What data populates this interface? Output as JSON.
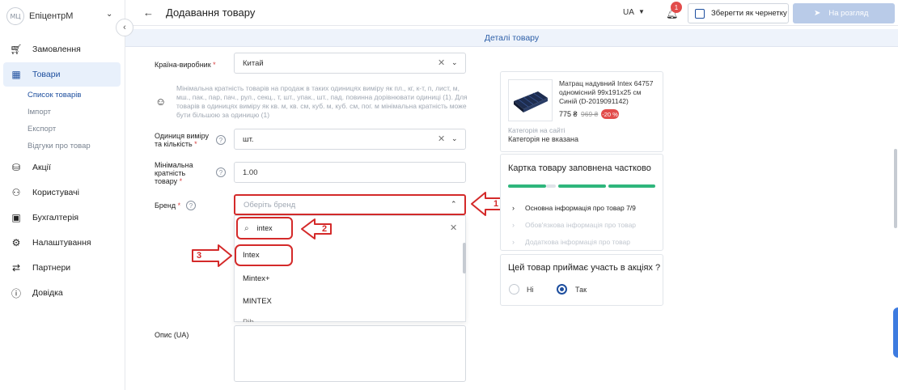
{
  "sidebar": {
    "logo_text": "МЦ",
    "brand_name": "ЕпіцентрМ",
    "items": [
      {
        "label": "Замовлення",
        "icon": "cart-icon"
      },
      {
        "label": "Товари",
        "icon": "box-icon"
      },
      {
        "label": "Акції",
        "icon": "promo-bag-icon"
      },
      {
        "label": "Користувачі",
        "icon": "users-icon"
      },
      {
        "label": "Бухгалтерія",
        "icon": "wallet-icon"
      },
      {
        "label": "Налаштування",
        "icon": "gear-icon"
      },
      {
        "label": "Партнери",
        "icon": "handshake-icon"
      },
      {
        "label": "Довідка",
        "icon": "help-icon"
      }
    ],
    "subitems": [
      "Список товарів",
      "Імпорт",
      "Експорт",
      "Відгуки про товар"
    ]
  },
  "topbar": {
    "title": "Додавання товару",
    "lang": "UA",
    "notifications": "1",
    "draft_label": "Зберегти як чернетку",
    "review_label": "На розгляд"
  },
  "section_title": "Деталі товару",
  "form": {
    "country_label": "Країна-виробник",
    "country_value": "Китай",
    "hint": "Мінімальна кратність товарів на продаж в таких одиницях виміру як пл., кг, к-т, п, лист, м, мш., пак., пар, пач., рул., секц., т, шт., упак., шт., пад. повинна дорівнювати одиниці (1). Для товарів в одиницях виміру як кв. м, кв. см, куб. м, куб. см, пог. м мінімальна кратність може бути більшою за одиницю (1)",
    "unit_label_1": "Одиниця виміру",
    "unit_label_2": "та кількість",
    "unit_value": "шт.",
    "min_label_1": "Мінімальна",
    "min_label_2": "кратність",
    "min_label_3": "товару",
    "min_value": "1.00",
    "brand_label": "Бренд",
    "brand_placeholder": "Оберіть бренд",
    "brand_search_value": "intex",
    "brand_options": [
      "Intex",
      "Mintex+",
      "MINTEX",
      "Pib..."
    ],
    "description_label": "Опис (UA)"
  },
  "callouts": [
    "1",
    "2",
    "3"
  ],
  "product": {
    "name": "Матрац надувний Intex 64757 одномісний 99x191x25 см Синій (D-2019091142)",
    "price": "775 ₴",
    "old_price": "969 ₴",
    "discount": "-20 %",
    "category_label": "Категорія на сайті",
    "category_value": "Категорія не вказана"
  },
  "fill": {
    "title": "Картка товару заповнена частково",
    "steps": [
      "Основна інформація про товар 7/9",
      "Обов'язкова інформація про товар",
      "Додаткова інформація про товар"
    ]
  },
  "promo": {
    "question": "Цей товар приймає участь в акціях ?",
    "options": [
      "Ні",
      "Так"
    ],
    "selected": "Так"
  },
  "colors": {
    "accent": "#1d4e9e",
    "annotation": "#d42a2a",
    "progress_done": "#2fb67c",
    "progress_empty": "#dfe3e8"
  }
}
